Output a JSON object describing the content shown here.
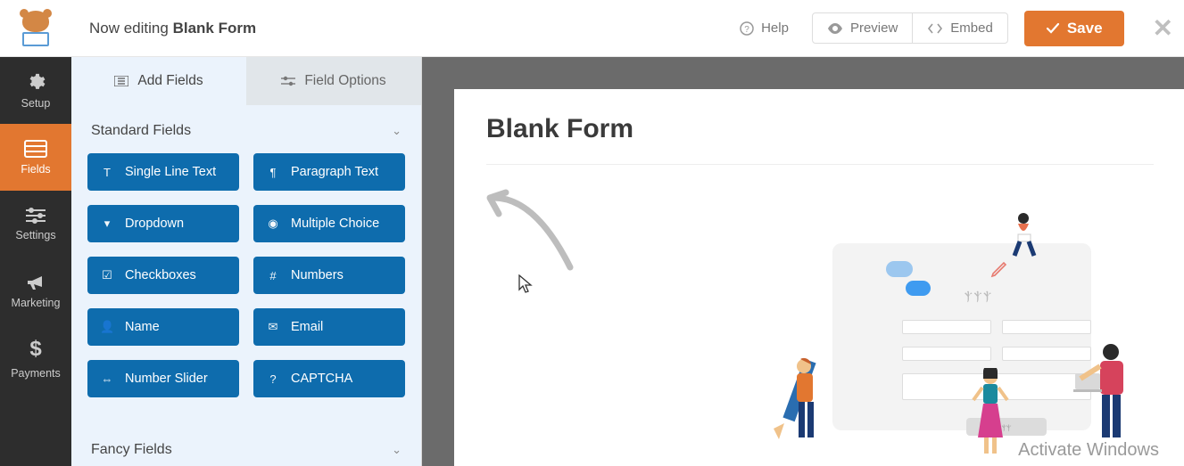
{
  "header": {
    "editing_prefix": "Now editing ",
    "form_name": "Blank Form",
    "help": "Help",
    "preview": "Preview",
    "embed": "Embed",
    "save": "Save"
  },
  "nav": {
    "items": [
      {
        "id": "setup",
        "label": "Setup",
        "icon": "⚙"
      },
      {
        "id": "fields",
        "label": "Fields",
        "icon": "▤"
      },
      {
        "id": "settings",
        "label": "Settings",
        "icon": "⟃"
      },
      {
        "id": "marketing",
        "label": "Marketing",
        "icon": "📣"
      },
      {
        "id": "payments",
        "label": "Payments",
        "icon": "$"
      }
    ],
    "active": "fields"
  },
  "panel": {
    "tabs": {
      "add": "Add Fields",
      "options": "Field Options",
      "active": "add"
    },
    "sections": {
      "standard": {
        "title": "Standard Fields",
        "fields": [
          {
            "label": "Single Line Text",
            "icon": "T"
          },
          {
            "label": "Paragraph Text",
            "icon": "¶"
          },
          {
            "label": "Dropdown",
            "icon": "▾"
          },
          {
            "label": "Multiple Choice",
            "icon": "◉"
          },
          {
            "label": "Checkboxes",
            "icon": "☑"
          },
          {
            "label": "Numbers",
            "icon": "#"
          },
          {
            "label": "Name",
            "icon": "👤"
          },
          {
            "label": "Email",
            "icon": "✉"
          },
          {
            "label": "Number Slider",
            "icon": "⇔"
          },
          {
            "label": "CAPTCHA",
            "icon": "?"
          }
        ]
      },
      "fancy": {
        "title": "Fancy Fields"
      }
    }
  },
  "canvas": {
    "form_title": "Blank Form"
  },
  "watermark": {
    "line1": "Activate Windows"
  }
}
